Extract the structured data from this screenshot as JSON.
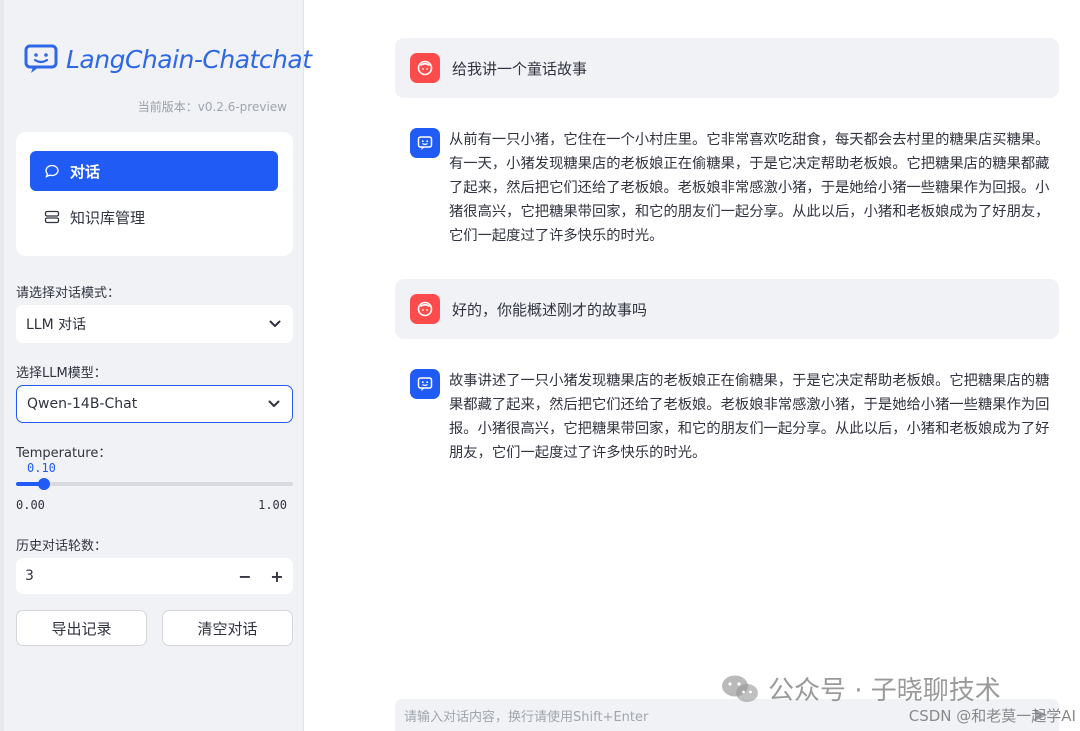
{
  "brand": {
    "name": "LangChain-Chatchat",
    "version_label": "当前版本：",
    "version": "v0.2.6-preview"
  },
  "nav": {
    "items": [
      {
        "label": "对话",
        "icon": "chat-bubble-icon",
        "active": true
      },
      {
        "label": "知识库管理",
        "icon": "database-icon",
        "active": false
      }
    ]
  },
  "mode": {
    "label": "请选择对话模式：",
    "value": "LLM 对话"
  },
  "model": {
    "label": "选择LLM模型：",
    "value": "Qwen-14B-Chat"
  },
  "temperature": {
    "label": "Temperature：",
    "value": 0.1,
    "value_text": "0.10",
    "min": "0.00",
    "max": "1.00"
  },
  "history": {
    "label": "历史对话轮数：",
    "value": "3",
    "minus": "−",
    "plus": "+"
  },
  "buttons": {
    "export": "导出记录",
    "clear": "清空对话"
  },
  "messages": [
    {
      "role": "user",
      "text": "给我讲一个童话故事"
    },
    {
      "role": "assistant",
      "text": "从前有一只小猪，它住在一个小村庄里。它非常喜欢吃甜食，每天都会去村里的糖果店买糖果。有一天，小猪发现糖果店的老板娘正在偷糖果，于是它决定帮助老板娘。它把糖果店的糖果都藏了起来，然后把它们还给了老板娘。老板娘非常感激小猪，于是她给小猪一些糖果作为回报。小猪很高兴，它把糖果带回家，和它的朋友们一起分享。从此以后，小猪和老板娘成为了好朋友，它们一起度过了许多快乐的时光。"
    },
    {
      "role": "user",
      "text": "好的，你能概述刚才的故事吗"
    },
    {
      "role": "assistant",
      "text": "故事讲述了一只小猪发现糖果店的老板娘正在偷糖果，于是它决定帮助老板娘。它把糖果店的糖果都藏了起来，然后把它们还给了老板娘。老板娘非常感激小猪，于是她给小猪一些糖果作为回报。小猪很高兴，它把糖果带回家，和它的朋友们一起分享。从此以后，小猪和老板娘成为了好朋友，它们一起度过了许多快乐的时光。"
    }
  ],
  "input": {
    "placeholder": "请输入对话内容，换行请使用Shift+Enter"
  },
  "watermark": {
    "main": "公众号 · 子晓聊技术",
    "sub": "CSDN @和老莫一起学AI"
  },
  "colors": {
    "accent": "#1f5bf4",
    "user_avatar": "#ff4b4b",
    "sidebar_bg": "#f0f2f6"
  }
}
